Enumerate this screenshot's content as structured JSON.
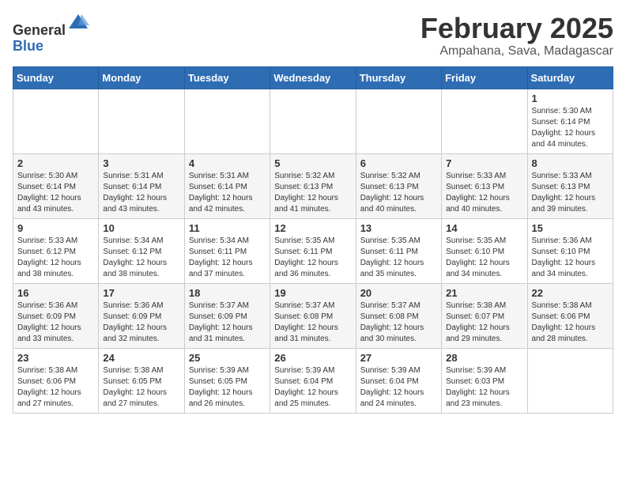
{
  "header": {
    "logo_general": "General",
    "logo_blue": "Blue",
    "month": "February 2025",
    "location": "Ampahana, Sava, Madagascar"
  },
  "days_of_week": [
    "Sunday",
    "Monday",
    "Tuesday",
    "Wednesday",
    "Thursday",
    "Friday",
    "Saturday"
  ],
  "weeks": [
    [
      {
        "day": "",
        "info": ""
      },
      {
        "day": "",
        "info": ""
      },
      {
        "day": "",
        "info": ""
      },
      {
        "day": "",
        "info": ""
      },
      {
        "day": "",
        "info": ""
      },
      {
        "day": "",
        "info": ""
      },
      {
        "day": "1",
        "info": "Sunrise: 5:30 AM\nSunset: 6:14 PM\nDaylight: 12 hours\nand 44 minutes."
      }
    ],
    [
      {
        "day": "2",
        "info": "Sunrise: 5:30 AM\nSunset: 6:14 PM\nDaylight: 12 hours\nand 43 minutes."
      },
      {
        "day": "3",
        "info": "Sunrise: 5:31 AM\nSunset: 6:14 PM\nDaylight: 12 hours\nand 43 minutes."
      },
      {
        "day": "4",
        "info": "Sunrise: 5:31 AM\nSunset: 6:14 PM\nDaylight: 12 hours\nand 42 minutes."
      },
      {
        "day": "5",
        "info": "Sunrise: 5:32 AM\nSunset: 6:13 PM\nDaylight: 12 hours\nand 41 minutes."
      },
      {
        "day": "6",
        "info": "Sunrise: 5:32 AM\nSunset: 6:13 PM\nDaylight: 12 hours\nand 40 minutes."
      },
      {
        "day": "7",
        "info": "Sunrise: 5:33 AM\nSunset: 6:13 PM\nDaylight: 12 hours\nand 40 minutes."
      },
      {
        "day": "8",
        "info": "Sunrise: 5:33 AM\nSunset: 6:13 PM\nDaylight: 12 hours\nand 39 minutes."
      }
    ],
    [
      {
        "day": "9",
        "info": "Sunrise: 5:33 AM\nSunset: 6:12 PM\nDaylight: 12 hours\nand 38 minutes."
      },
      {
        "day": "10",
        "info": "Sunrise: 5:34 AM\nSunset: 6:12 PM\nDaylight: 12 hours\nand 38 minutes."
      },
      {
        "day": "11",
        "info": "Sunrise: 5:34 AM\nSunset: 6:11 PM\nDaylight: 12 hours\nand 37 minutes."
      },
      {
        "day": "12",
        "info": "Sunrise: 5:35 AM\nSunset: 6:11 PM\nDaylight: 12 hours\nand 36 minutes."
      },
      {
        "day": "13",
        "info": "Sunrise: 5:35 AM\nSunset: 6:11 PM\nDaylight: 12 hours\nand 35 minutes."
      },
      {
        "day": "14",
        "info": "Sunrise: 5:35 AM\nSunset: 6:10 PM\nDaylight: 12 hours\nand 34 minutes."
      },
      {
        "day": "15",
        "info": "Sunrise: 5:36 AM\nSunset: 6:10 PM\nDaylight: 12 hours\nand 34 minutes."
      }
    ],
    [
      {
        "day": "16",
        "info": "Sunrise: 5:36 AM\nSunset: 6:09 PM\nDaylight: 12 hours\nand 33 minutes."
      },
      {
        "day": "17",
        "info": "Sunrise: 5:36 AM\nSunset: 6:09 PM\nDaylight: 12 hours\nand 32 minutes."
      },
      {
        "day": "18",
        "info": "Sunrise: 5:37 AM\nSunset: 6:09 PM\nDaylight: 12 hours\nand 31 minutes."
      },
      {
        "day": "19",
        "info": "Sunrise: 5:37 AM\nSunset: 6:08 PM\nDaylight: 12 hours\nand 31 minutes."
      },
      {
        "day": "20",
        "info": "Sunrise: 5:37 AM\nSunset: 6:08 PM\nDaylight: 12 hours\nand 30 minutes."
      },
      {
        "day": "21",
        "info": "Sunrise: 5:38 AM\nSunset: 6:07 PM\nDaylight: 12 hours\nand 29 minutes."
      },
      {
        "day": "22",
        "info": "Sunrise: 5:38 AM\nSunset: 6:06 PM\nDaylight: 12 hours\nand 28 minutes."
      }
    ],
    [
      {
        "day": "23",
        "info": "Sunrise: 5:38 AM\nSunset: 6:06 PM\nDaylight: 12 hours\nand 27 minutes."
      },
      {
        "day": "24",
        "info": "Sunrise: 5:38 AM\nSunset: 6:05 PM\nDaylight: 12 hours\nand 27 minutes."
      },
      {
        "day": "25",
        "info": "Sunrise: 5:39 AM\nSunset: 6:05 PM\nDaylight: 12 hours\nand 26 minutes."
      },
      {
        "day": "26",
        "info": "Sunrise: 5:39 AM\nSunset: 6:04 PM\nDaylight: 12 hours\nand 25 minutes."
      },
      {
        "day": "27",
        "info": "Sunrise: 5:39 AM\nSunset: 6:04 PM\nDaylight: 12 hours\nand 24 minutes."
      },
      {
        "day": "28",
        "info": "Sunrise: 5:39 AM\nSunset: 6:03 PM\nDaylight: 12 hours\nand 23 minutes."
      },
      {
        "day": "",
        "info": ""
      }
    ]
  ]
}
